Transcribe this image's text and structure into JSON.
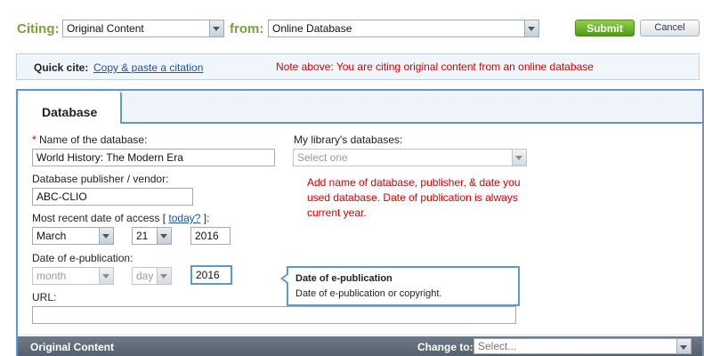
{
  "citing": {
    "label": "Citing:",
    "type_value": "Original Content",
    "from_label": "from:",
    "source_value": "Online Database"
  },
  "actions": {
    "submit": "Submit",
    "cancel": "Cancel"
  },
  "quick_cite": {
    "label": "Quick cite:",
    "link": "Copy & paste a citation",
    "note": "Note above: You are citing original content from an online database"
  },
  "tab": {
    "label": "Database"
  },
  "form": {
    "required_mark": "*",
    "db_name_label": " Name of the database:",
    "db_name_value": "World History: The Modern Era",
    "library_label": "My library's databases:",
    "library_value": "Select one",
    "publisher_label": "Database publisher / vendor:",
    "publisher_value": "ABC-CLIO",
    "access_label_prefix": "Most recent date of access [ ",
    "access_today": "today?",
    "access_label_suffix": " ]:",
    "access_month": "March",
    "access_day": "21",
    "access_year": "2016",
    "epub_label": "Date of e-publication:",
    "epub_month": "month",
    "epub_day": "day",
    "epub_year": "2016",
    "url_label": "URL:",
    "url_value": ""
  },
  "annotation": "Add name of database, publisher, & date you used database. Date of publication is always current year.",
  "tooltip": {
    "title": "Date of e-publication",
    "body": "Date of e-publication or copyright."
  },
  "footer": {
    "title": "Original Content",
    "change_label": "Change to:",
    "change_value": "Select..."
  },
  "colors": {
    "accent_green": "#7aa23a",
    "panel_blue": "#5b9ad0",
    "note_red": "#d40000",
    "link_blue": "#1c56a5"
  }
}
